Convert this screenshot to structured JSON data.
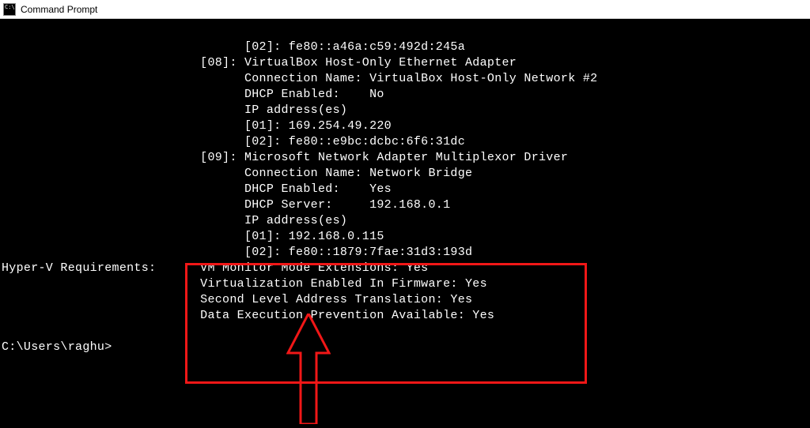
{
  "window": {
    "title": "Command Prompt"
  },
  "terminal": {
    "lines": [
      "                                 [02]: fe80::a46a:c59:492d:245a",
      "                           [08]: VirtualBox Host-Only Ethernet Adapter",
      "                                 Connection Name: VirtualBox Host-Only Network #2",
      "                                 DHCP Enabled:    No",
      "                                 IP address(es)",
      "                                 [01]: 169.254.49.220",
      "                                 [02]: fe80::e9bc:dcbc:6f6:31dc",
      "                           [09]: Microsoft Network Adapter Multiplexor Driver",
      "                                 Connection Name: Network Bridge",
      "                                 DHCP Enabled:    Yes",
      "                                 DHCP Server:     192.168.0.1",
      "                                 IP address(es)",
      "                                 [01]: 192.168.0.115",
      "                                 [02]: fe80::1879:7fae:31d3:193d",
      "Hyper-V Requirements:      VM Monitor Mode Extensions: Yes",
      "                           Virtualization Enabled In Firmware: Yes",
      "                           Second Level Address Translation: Yes",
      "                           Data Execution Prevention Available: Yes",
      "",
      "C:\\Users\\raghu>"
    ]
  },
  "annotation": {
    "box_color": "#f11717"
  }
}
